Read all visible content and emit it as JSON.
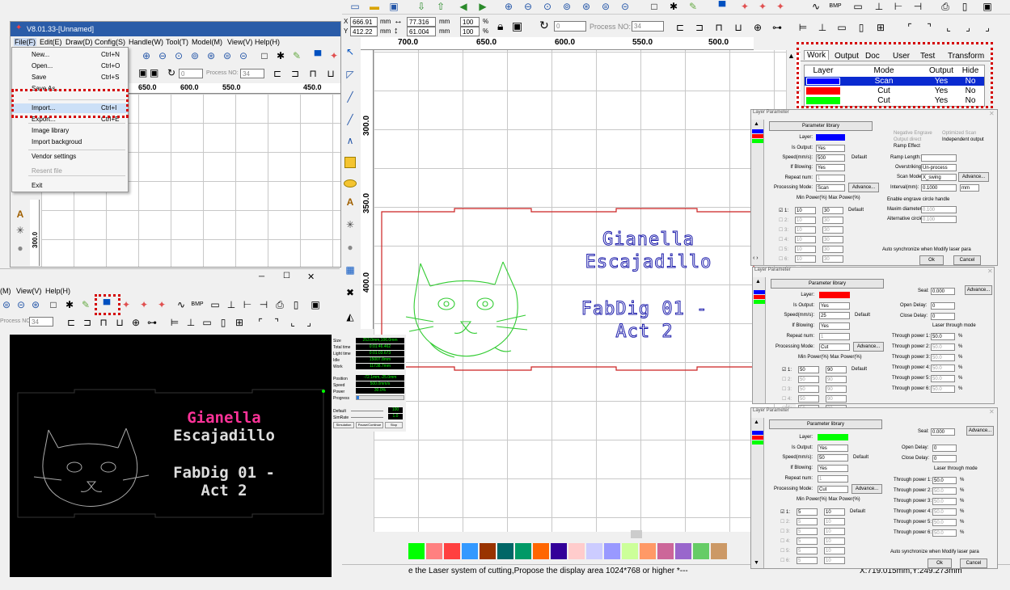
{
  "top_toolbar": {
    "pos_x": "666.91",
    "pos_y": "412.22",
    "unit_mm": "mm",
    "width": "77.316",
    "height": "61.004",
    "pct1": "100",
    "pct2": "100",
    "pct_sym": "%",
    "rotate": "0",
    "process_label": "Process NO:",
    "process_no": "34"
  },
  "main_ruler": {
    "top_ticks": [
      "700.0",
      "650.0",
      "600.0",
      "550.0",
      "500.0"
    ],
    "left_ticks": [
      "300.0",
      "350.0",
      "400.0"
    ]
  },
  "design": {
    "line1": "Gianella",
    "line2": "Escajadillo",
    "line3": "FabDig 01 -",
    "line4": "Act 2"
  },
  "work_panel": {
    "tabs": [
      "Work",
      "Output",
      "Doc",
      "User",
      "Test",
      "Transform"
    ],
    "headers": [
      "Layer",
      "Mode",
      "Output",
      "Hide"
    ],
    "rows": [
      {
        "color": "#0000ff",
        "mode": "Scan",
        "output": "Yes",
        "hide": "No"
      },
      {
        "color": "#ff0000",
        "mode": "Cut",
        "output": "Yes",
        "hide": "No"
      },
      {
        "color": "#00ff00",
        "mode": "Cut",
        "output": "Yes",
        "hide": "No"
      }
    ]
  },
  "lp_common": {
    "title": "Layer Parameter",
    "library": "Parameter library",
    "layer": "Layer:",
    "is_output": "Is Output:",
    "speed": "Speed(mm/s):",
    "blowing": "If Blowing:",
    "repeat": "Repeat num:",
    "proc_mode": "Processing Mode:",
    "advance": "Advance...",
    "default": "Default",
    "minmax": "Min Power(%) Max Power(%)",
    "auto_sync": "Auto synchronize when Modify laser para",
    "ok": "Ok",
    "cancel": "Cancel",
    "yes": "Yes",
    "seal": "Seal:",
    "open_delay": "Open Delay:",
    "close_delay": "Close Delay:",
    "through_mode": "Laser through mode",
    "ms": "ms",
    "mm": "mm",
    "pct": "%"
  },
  "lp1": {
    "speed": "500",
    "mode": "Scan",
    "powers": [
      [
        "10",
        "30"
      ],
      [
        "10",
        "30"
      ],
      [
        "10",
        "30"
      ],
      [
        "10",
        "30"
      ],
      [
        "10",
        "30"
      ],
      [
        "10",
        "30"
      ]
    ],
    "scan": {
      "neg": "Negative Engrave",
      "opt": "Optimized Scan",
      "outdir": "Output direct",
      "indep": "Independent output",
      "ramp": "Ramp Effect",
      "ramp_len": "Ramp Length:",
      "over": "Overstriking:",
      "over_val": "Un-process",
      "scan_mode": "Scan Mode:",
      "scan_mode_val": "X_swing",
      "interval": "Interval(mm):",
      "interval_val": "0.1000",
      "enable_circle": "Enable engrave circle handle",
      "max_dia": "Maxim diameter:",
      "max_dia_val": "0.100",
      "alt_circle": "Alternative circle",
      "alt_val": "0.100"
    }
  },
  "lp2": {
    "speed": "25",
    "mode": "Cut",
    "seal": "0.000",
    "open": "0",
    "close": "0",
    "powers": [
      [
        "50",
        "90"
      ],
      [
        "50",
        "90"
      ],
      [
        "50",
        "90"
      ],
      [
        "50",
        "90"
      ],
      [
        "50",
        "90"
      ],
      [
        "50",
        "90"
      ]
    ],
    "through": [
      "50.0",
      "50.0",
      "50.0",
      "50.0",
      "50.0",
      "50.0"
    ]
  },
  "lp3": {
    "speed": "50",
    "mode": "Cut",
    "seal": "0.000",
    "open": "0",
    "close": "0",
    "powers": [
      [
        "5",
        "10"
      ],
      [
        "5",
        "10"
      ],
      [
        "5",
        "10"
      ],
      [
        "5",
        "10"
      ],
      [
        "5",
        "10"
      ],
      [
        "5",
        "10"
      ]
    ],
    "through": [
      "50.0",
      "50.0",
      "50.0",
      "50.0",
      "50.0",
      "50.0"
    ]
  },
  "through_labels": [
    "Through power 1:",
    "Through power 2:",
    "Through power 3:",
    "Through power 4:",
    "Through power 5:",
    "Through power 6:"
  ],
  "small_window": {
    "title": "V8.01.33-[Unnamed]",
    "menubar": [
      "File(F)",
      "Edit(E)",
      "Draw(D)",
      "Config(S)",
      "Handle(W)",
      "Tool(T)",
      "Model(M)",
      "View(V)",
      "Help(H)"
    ],
    "rotate": "0",
    "process_label": "Process NO:",
    "process_no": "34",
    "ticks": [
      "650.0",
      "600.0",
      "550.0",
      "450.0"
    ]
  },
  "file_menu": {
    "items": [
      {
        "label": "New...",
        "key": "Ctrl+N"
      },
      {
        "label": "Open...",
        "key": "Ctrl+O"
      },
      {
        "label": "Save",
        "key": "Ctrl+S"
      },
      {
        "label": "Save As...",
        "key": ""
      },
      {
        "label": "Import...",
        "key": "Ctrl+I"
      },
      {
        "label": "Export...",
        "key": "Ctrl+E"
      },
      {
        "label": "Image library",
        "key": ""
      },
      {
        "label": "Import backgroud",
        "key": ""
      },
      {
        "label": "Vendor settings",
        "key": ""
      },
      {
        "label": "Resent file",
        "key": ""
      },
      {
        "label": "Exit",
        "key": ""
      }
    ]
  },
  "mid_window": {
    "menubar": [
      "(M)",
      "View(V)",
      "Help(H)"
    ],
    "process_label": "Process NO:",
    "process_no": "34"
  },
  "sim": {
    "stats": [
      {
        "label": "Size",
        "value": "253.0mm,106.0mm"
      },
      {
        "label": "Total time",
        "value": "0:01:46.462"
      },
      {
        "label": "Light time",
        "value": "0:01:03.673"
      },
      {
        "label": "Idle",
        "value": "15007.8mm"
      },
      {
        "label": "Work",
        "value": "11738.7mm"
      }
    ],
    "pos_label": "Position",
    "pos": "-72.1mm,-25.0mm",
    "speed_label": "Speed",
    "speed": "500.0mm/s",
    "power_label": "Power",
    "power": "30.0%",
    "progress_label": "Progress",
    "progress": 0.05,
    "default_label": "Default",
    "default_val": "100",
    "simrate_label": "SimRate",
    "simrate_val": "1.0",
    "buttons": [
      "Simulation",
      "Pause/Continue",
      "Stop"
    ]
  },
  "status_bar": "e the Laser system of cutting,Propose the display area 1024*768 or higher *---",
  "coords": "X:719.015mm,Y:249.273mm",
  "palette": [
    "#00ff00",
    "#ff8080",
    "#ff4040",
    "#3399ff",
    "#993300",
    "#006666",
    "#009966",
    "#ff6600",
    "#330099",
    "#ffcccc",
    "#ccccff",
    "#9999ff",
    "#ccff99",
    "#ff9966",
    "#cc6699",
    "#9966cc",
    "#66cc66",
    "#cc9966"
  ],
  "colors": {
    "accent_red": "#d40000",
    "sim_green": "#00ff00",
    "design_blue": "#1a1aaa",
    "cut_red": "#cc2222",
    "cat_green": "#33cc33",
    "pink": "#ff3399"
  }
}
